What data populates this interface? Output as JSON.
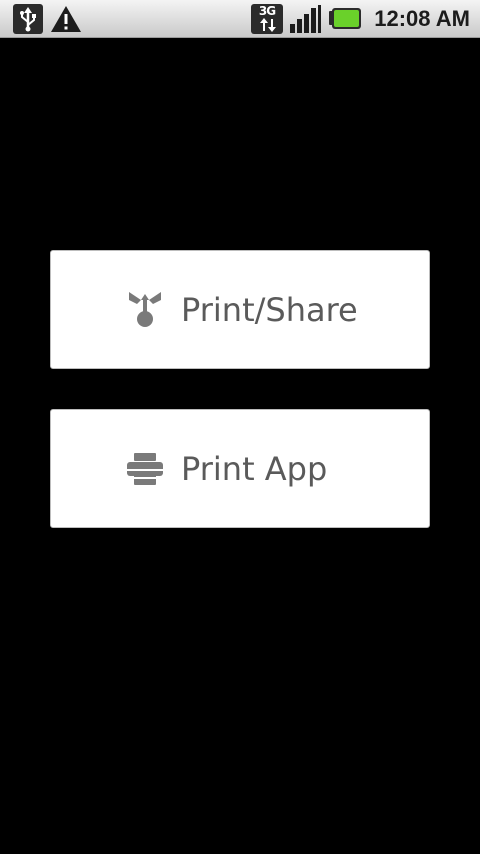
{
  "status_bar": {
    "time": "12:08 AM",
    "network_label": "3G",
    "icons": [
      "usb-icon",
      "warning-icon",
      "network-3g-icon",
      "signal-icon",
      "battery-icon"
    ],
    "battery_color": "#6ad12a"
  },
  "buttons": [
    {
      "label": "Print/Share",
      "icon": "print-share-icon"
    },
    {
      "label": "Print App",
      "icon": "printer-icon"
    }
  ],
  "colors": {
    "background": "#000000",
    "button_bg": "#ffffff",
    "label_text": "#5a5a5a",
    "icon_gray": "#7a7a7a"
  }
}
